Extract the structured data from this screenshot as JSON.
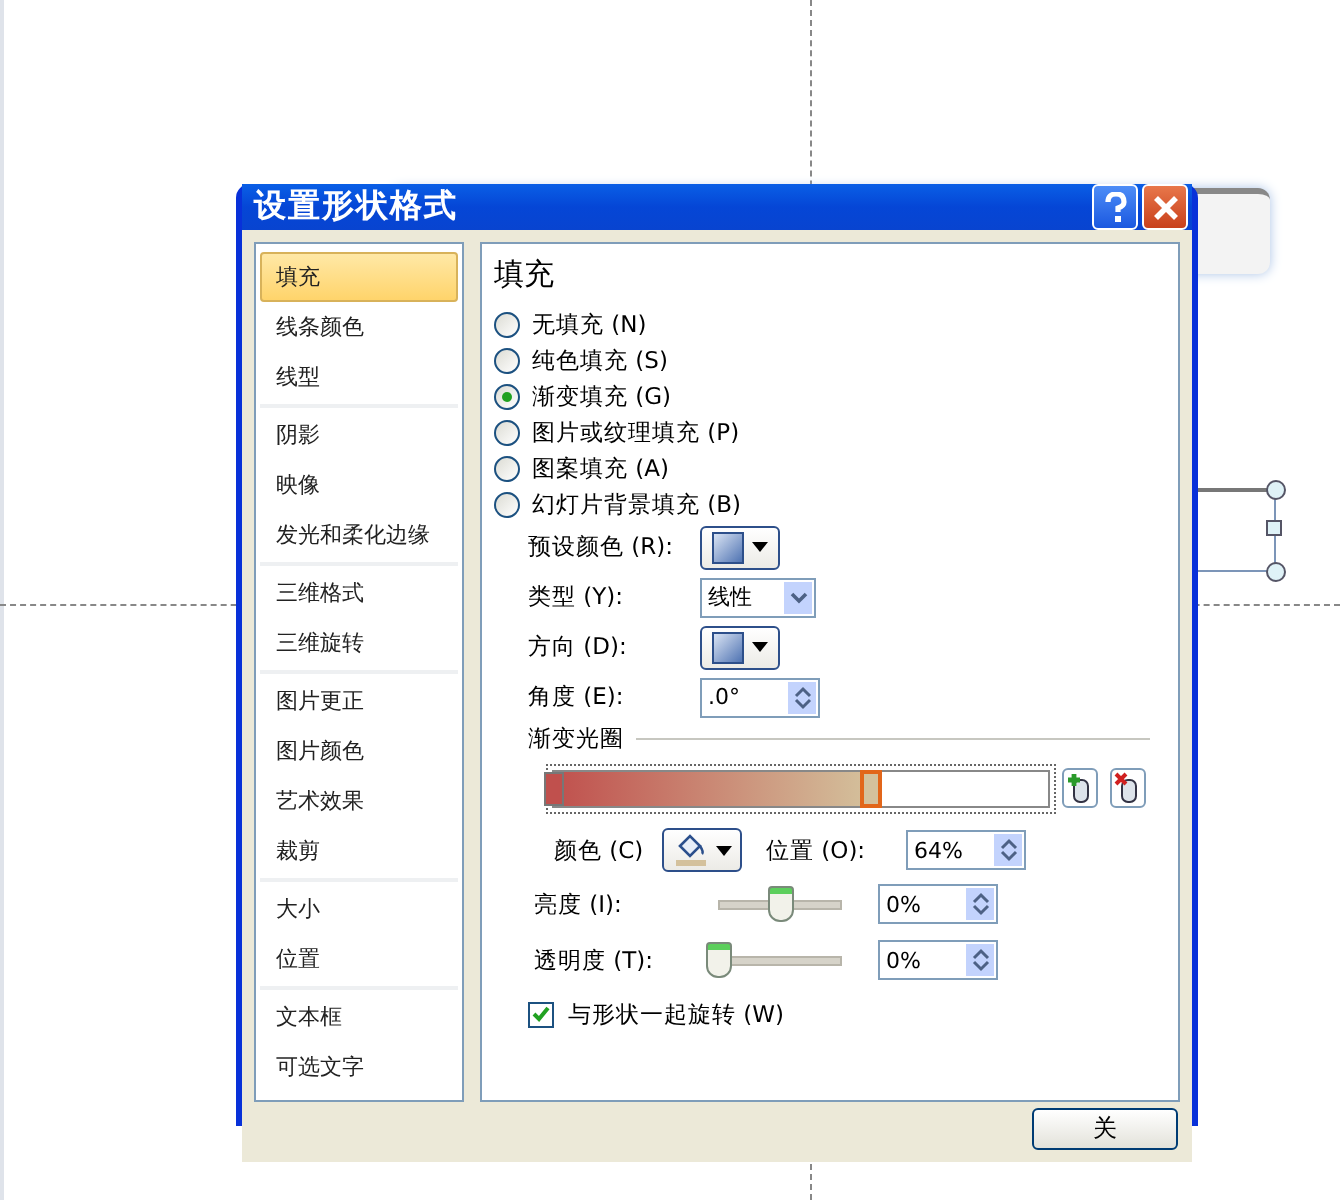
{
  "window": {
    "title": "设置形状格式",
    "close_label": "关"
  },
  "sidebar": {
    "groups": [
      {
        "items": [
          {
            "label": "填充",
            "selected": true
          },
          {
            "label": "线条颜色",
            "selected": false
          },
          {
            "label": "线型",
            "selected": false
          }
        ]
      },
      {
        "items": [
          {
            "label": "阴影",
            "selected": false
          },
          {
            "label": "映像",
            "selected": false
          },
          {
            "label": "发光和柔化边缘",
            "selected": false
          }
        ]
      },
      {
        "items": [
          {
            "label": "三维格式",
            "selected": false
          },
          {
            "label": "三维旋转",
            "selected": false
          }
        ]
      },
      {
        "items": [
          {
            "label": "图片更正",
            "selected": false
          },
          {
            "label": "图片颜色",
            "selected": false
          },
          {
            "label": "艺术效果",
            "selected": false
          },
          {
            "label": "裁剪",
            "selected": false
          }
        ]
      },
      {
        "items": [
          {
            "label": "大小",
            "selected": false
          },
          {
            "label": "位置",
            "selected": false
          }
        ]
      },
      {
        "items": [
          {
            "label": "文本框",
            "selected": false
          },
          {
            "label": "可选文字",
            "selected": false
          }
        ]
      }
    ]
  },
  "panel": {
    "heading": "填充",
    "fill_options": [
      {
        "label": "无填充 (N)",
        "selected": false
      },
      {
        "label": "纯色填充 (S)",
        "selected": false
      },
      {
        "label": "渐变填充 (G)",
        "selected": true
      },
      {
        "label": "图片或纹理填充 (P)",
        "selected": false
      },
      {
        "label": "图案填充 (A)",
        "selected": false
      },
      {
        "label": "幻灯片背景填充 (B)",
        "selected": false
      }
    ],
    "preset_color": {
      "label": "预设颜色 (R):"
    },
    "type": {
      "label": "类型 (Y):",
      "value": "线性"
    },
    "direction": {
      "label": "方向 (D):"
    },
    "angle": {
      "label": "角度 (E):",
      "value": ".0°"
    },
    "gradient_stops": {
      "title": "渐变光圈",
      "stops": [
        {
          "level": 0,
          "color": "#c0504d",
          "selected": false
        },
        {
          "level": 0.64,
          "color": "#d4c19c",
          "selected": true
        }
      ]
    },
    "color": {
      "label": "颜色 (C)"
    },
    "position": {
      "label": "位置 (O):",
      "value": "64%"
    },
    "brightness": {
      "label": "亮度 (I):",
      "value": "0%",
      "level": 0.5
    },
    "transparency": {
      "label": "透明度 (T):",
      "value": "0%",
      "level": 0
    },
    "rotate_with_shape": {
      "label": "与形状一起旋转 (W)",
      "checked": true
    }
  }
}
